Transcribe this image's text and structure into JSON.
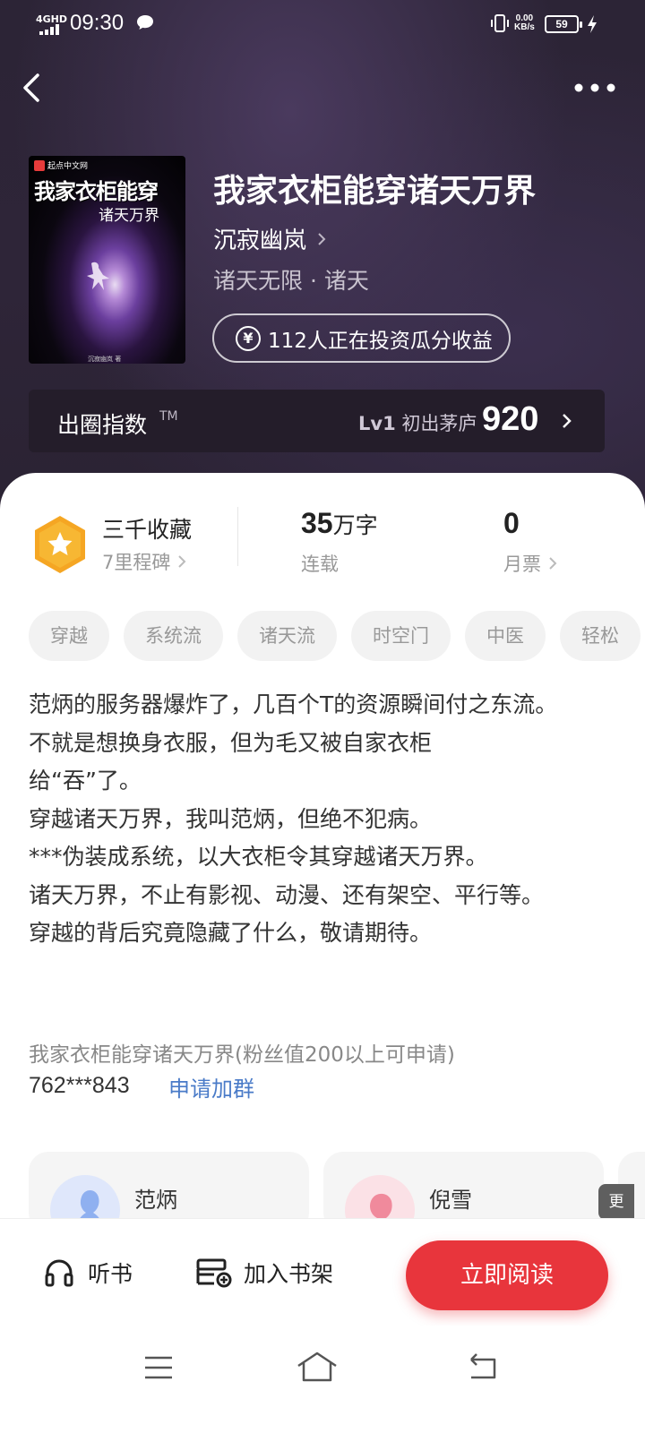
{
  "status_bar": {
    "network": "4GHD",
    "time": "09:30",
    "net_speed_value": "0.00",
    "net_speed_unit": "KB/s",
    "battery": "59"
  },
  "header": {
    "back_icon": "chevron-left-icon",
    "more_icon": "more-dots-icon"
  },
  "book": {
    "title": "我家衣柜能穿诸天万界",
    "author": "沉寂幽岚",
    "genre": "诸天无限 · 诸天",
    "invest_text": "112人正在投资瓜分收益",
    "invest_icon": "yen-icon",
    "cover": {
      "badge": "起点中文网",
      "title": "我家衣柜能穿",
      "subtitle": "诸天万界",
      "author": "沉寂幽岚 著"
    }
  },
  "index": {
    "label": "出圈指数",
    "tm": "TM",
    "level_code": "Lv1",
    "level_name": "初出茅庐",
    "score": "920"
  },
  "stats": {
    "collect_main": "三千收藏",
    "collect_sub": "7里程碑",
    "words_num": "35",
    "words_unit": "万字",
    "words_sub": "连载",
    "monthly_num": "0",
    "monthly_sub": "月票"
  },
  "tags": [
    "穿越",
    "系统流",
    "诸天流",
    "时空门",
    "中医",
    "轻松"
  ],
  "description": [
    "范炳的服务器爆炸了，几百个T的资源瞬间付之东流。",
    "不就是想换身衣服，但为毛又被自家衣柜",
    "给“吞”了。",
    "穿越诸天万界，我叫范炳，但绝不犯病。",
    "***伪装成系统，以大衣柜令其穿越诸天万界。",
    "诸天万界，不止有影视、动漫、还有架空、平行等。",
    "穿越的背后究竟隐藏了什么，敬请期待。"
  ],
  "group": {
    "line": "我家衣柜能穿诸天万界(粉丝值200以上可申请)",
    "number": "762***843",
    "apply": "申请加群"
  },
  "characters": [
    {
      "name": "范炳",
      "color": "#8fb0f0"
    },
    {
      "name": "倪雪",
      "color": "#f08a9c"
    }
  ],
  "more_tab": "更",
  "actions": {
    "listen": "听书",
    "shelf": "加入书架",
    "read": "立即阅读"
  },
  "colors": {
    "accent_red": "#e8353c",
    "link_blue": "#4a7bc8",
    "medal_orange": "#f5a623"
  }
}
